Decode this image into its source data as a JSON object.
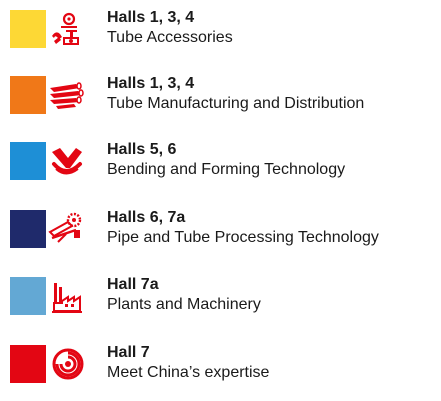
{
  "legend": {
    "items": [
      {
        "halls": "Halls 1, 3, 4",
        "category": "Tube Accessories",
        "color": "#fdd835",
        "icon": "tube-accessories-icon"
      },
      {
        "halls": "Halls 1, 3, 4",
        "category": "Tube Manufacturing and Distribution",
        "color": "#f07818",
        "icon": "stacked-tubes-icon"
      },
      {
        "halls": "Halls 5, 6",
        "category": "Bending and Forming Technology",
        "color": "#1e8fd6",
        "icon": "bent-pipe-icon"
      },
      {
        "halls": "Halls 6, 7a",
        "category": "Pipe and Tube Processing Technology",
        "color": "#1f2a6b",
        "icon": "saw-cutting-icon"
      },
      {
        "halls": "Hall 7a",
        "category": "Plants and Machinery",
        "color": "#63a8d4",
        "icon": "factory-icon"
      },
      {
        "halls": "Hall 7",
        "category": "Meet China’s expertise",
        "color": "#e30613",
        "icon": "china-spiral-icon"
      }
    ],
    "icon_color": "#e30613"
  }
}
